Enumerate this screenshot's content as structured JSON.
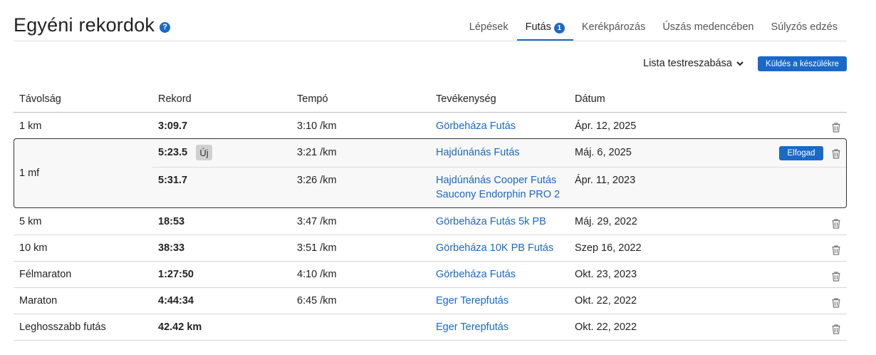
{
  "header": {
    "title": "Egyéni rekordok",
    "help_icon": "?"
  },
  "tabs": [
    {
      "label": "Lépések"
    },
    {
      "label": "Futás",
      "badge": "1"
    },
    {
      "label": "Kerékpározás"
    },
    {
      "label": "Úszás medencében"
    },
    {
      "label": "Súlyzós edzés"
    }
  ],
  "toolbar": {
    "customize_label": "Lista testreszabása",
    "send_label": "Küldés a készülékre"
  },
  "table": {
    "headers": [
      "Távolság",
      "Rekord",
      "Tempó",
      "Tevékenység",
      "Dátum"
    ],
    "rows": [
      {
        "distance": "1 km",
        "record": "3:09.7",
        "pace": "3:10 /km",
        "activity": "Görbeháza Futás",
        "date": "Ápr. 12, 2025"
      },
      {
        "distance": "1 mf",
        "pending": {
          "record": "5:23.5",
          "badge": "Új",
          "pace": "3:21 /km",
          "activity": "Hajdúnánás Futás",
          "date": "Máj. 6, 2025",
          "accept_label": "Elfogad"
        },
        "current": {
          "record": "5:31.7",
          "pace": "3:26 /km",
          "activity_line1": "Hajdúnánás Cooper Futás",
          "activity_line2": "Saucony Endorphin PRO 2",
          "date": "Ápr. 11, 2023"
        }
      },
      {
        "distance": "5 km",
        "record": "18:53",
        "pace": "3:47 /km",
        "activity": "Görbeháza Futás 5k PB",
        "date": "Máj. 29, 2022"
      },
      {
        "distance": "10 km",
        "record": "38:33",
        "pace": "3:51 /km",
        "activity": "Görbeháza 10K PB Futás",
        "date": "Szep 16, 2022"
      },
      {
        "distance": "Félmaraton",
        "record": "1:27:50",
        "pace": "4:10 /km",
        "activity": "Görbeháza Futás",
        "date": "Okt. 23, 2023"
      },
      {
        "distance": "Maraton",
        "record": "4:44:34",
        "pace": "6:45 /km",
        "activity": "Eger Terepfutás",
        "date": "Okt. 22, 2022"
      },
      {
        "distance": "Leghosszabb futás",
        "record": "42.42 km",
        "pace": "",
        "activity": "Eger Terepfutás",
        "date": "Okt. 22, 2022"
      }
    ]
  },
  "icons": {
    "help": "help-icon",
    "chevron": "chevron-down-icon",
    "delete": "trash-icon"
  },
  "colors": {
    "accent": "#1a68c7",
    "link": "#1a68c7",
    "new_badge_bg": "#d0d0d0"
  }
}
